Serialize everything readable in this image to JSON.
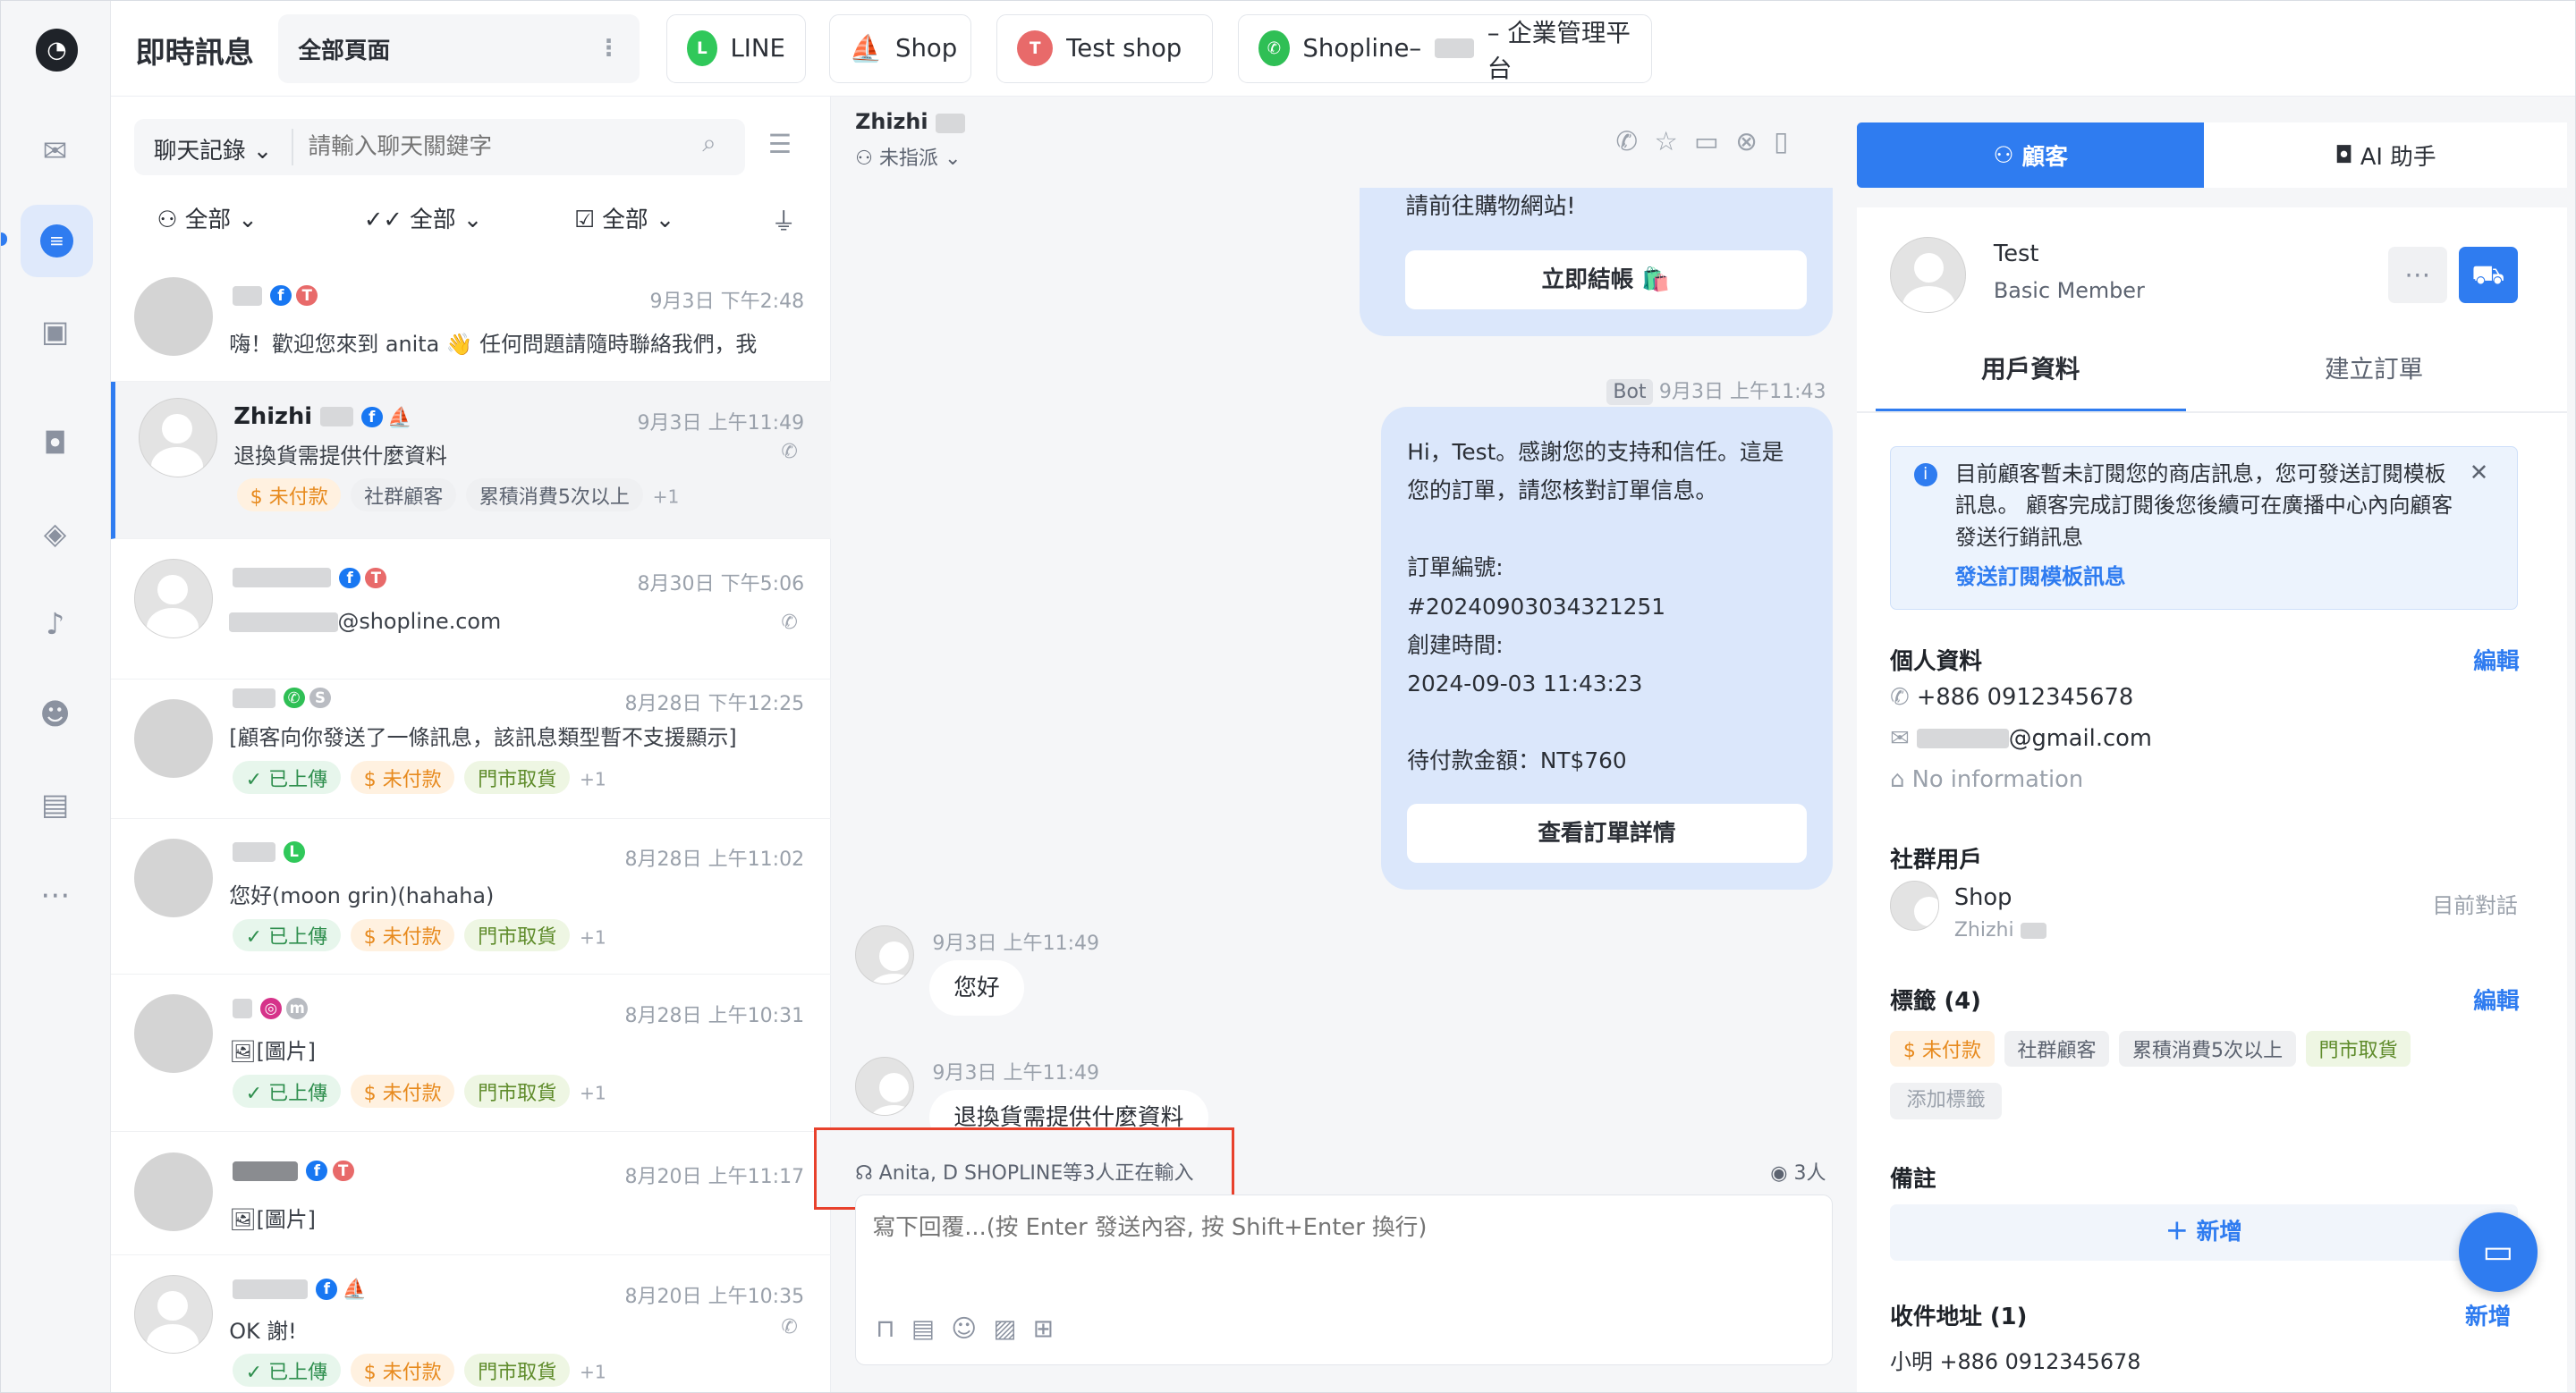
{
  "app": {
    "title": "即時訊息",
    "page_select": "全部頁面"
  },
  "channels": [
    {
      "label": "LINE",
      "icon": "line-icon"
    },
    {
      "label": "Shop",
      "icon": "shop-facebook-icon"
    },
    {
      "label": "Test shop",
      "icon": "test-shop-icon"
    },
    {
      "label": "Shopline–",
      "suffix": "– 企業管理平台",
      "icon": "whatsapp-icon"
    }
  ],
  "rail": [
    "inbox-icon",
    "chat-icon",
    "gallery-icon",
    "bot-icon",
    "tag-icon",
    "bell-icon",
    "agent-icon",
    "broadcast-icon",
    "more-icon"
  ],
  "list": {
    "history_select": "聊天記錄",
    "search_placeholder": "請輸入聊天關鍵字",
    "filters": [
      "全部",
      "全部",
      "全部"
    ],
    "conversations": [
      {
        "name": "",
        "time": "9月3日 下午2:48",
        "message": "嗨！歡迎您來到 anita 👋 任何問題請隨時聯絡我們，我",
        "tags": [],
        "plus": ""
      },
      {
        "name": "Zhizhi",
        "time": "9月3日 上午11:49",
        "message": "退換貨需提供什麼資料",
        "tags": [
          {
            "t": "$ 未付款",
            "c": "orange"
          },
          {
            "t": "社群顧客",
            "c": "gray"
          },
          {
            "t": "累積消費5次以上",
            "c": "gray"
          }
        ],
        "plus": "+1"
      },
      {
        "name": "",
        "time": "8月30日 下午5:06",
        "message": "@shopline.com",
        "tags": [],
        "plus": ""
      },
      {
        "name": "",
        "time": "8月28日 下午12:25",
        "message": "[顧客向你發送了一條訊息，該訊息類型暫不支援顯示]",
        "tags": [
          {
            "t": "✓ 已上傳",
            "c": "green"
          },
          {
            "t": "$ 未付款",
            "c": "orange"
          },
          {
            "t": "門市取貨",
            "c": "lime"
          }
        ],
        "plus": "+1"
      },
      {
        "name": "",
        "time": "8月28日 上午11:02",
        "message": "您好(moon grin)(hahaha)",
        "tags": [
          {
            "t": "✓ 已上傳",
            "c": "green"
          },
          {
            "t": "$ 未付款",
            "c": "orange"
          },
          {
            "t": "門市取貨",
            "c": "lime"
          }
        ],
        "plus": "+1"
      },
      {
        "name": "",
        "time": "8月28日 上午10:31",
        "message": "[圖片]",
        "tags": [
          {
            "t": "✓ 已上傳",
            "c": "green"
          },
          {
            "t": "$ 未付款",
            "c": "orange"
          },
          {
            "t": "門市取貨",
            "c": "lime"
          }
        ],
        "plus": "+1"
      },
      {
        "name": "",
        "time": "8月20日 上午11:17",
        "message": "[圖片]",
        "tags": [],
        "plus": ""
      },
      {
        "name": "",
        "time": "8月20日 上午10:35",
        "message": "OK 謝!",
        "tags": [
          {
            "t": "✓ 已上傳",
            "c": "green"
          },
          {
            "t": "$ 未付款",
            "c": "orange"
          },
          {
            "t": "門市取貨",
            "c": "lime"
          }
        ],
        "plus": "+1"
      }
    ]
  },
  "chat": {
    "name": "Zhizhi",
    "assign": "未指派",
    "bubble1_text": "請前往購物網站!",
    "bubble1_button": "立即結帳 🛍️",
    "bot_label": "Bot",
    "bot_time": "9月3日 上午11:43",
    "bubble2_lines": [
      "Hi，Test。感謝您的支持和信任。這是",
      "您的訂單，請您核對訂單信息。",
      "",
      "訂單編號:",
      "#20240903034321251",
      "創建時間:",
      "2024-09-03 11:43:23",
      "",
      "待付款金額：NT$760"
    ],
    "bubble2_button": "查看訂單詳情",
    "msg1_time": "9月3日 上午11:49",
    "msg1_text": "您好",
    "msg2_time": "9月3日 上午11:49",
    "msg2_text": "退換貨需提供什麼資料",
    "typing": "Anita, D SHOPLINE等3人正在輸入",
    "viewers": "3人",
    "input_placeholder": "寫下回覆...(按 Enter 發送內容, 按 Shift+Enter 換行)"
  },
  "panel": {
    "tab_customer": "顧客",
    "tab_ai": "AI 助手",
    "customer_name": "Test",
    "member": "Basic Member",
    "subtab_profile": "用戶資料",
    "subtab_order": "建立訂單",
    "notice": "目前顧客暫未訂閱您的商店訊息，您可發送訂閱模板訊息。 顧客完成訂閱後您後續可在廣播中心內向顧客發送行銷訊息",
    "notice_link": "發送訂閱模板訊息",
    "personal_title": "個人資料",
    "edit": "編輯",
    "phone": "+886 0912345678",
    "email": "@gmail.com",
    "no_info": "No information",
    "social_title": "社群用戶",
    "social_name": "Shop",
    "social_sub": "Zhizhi",
    "social_status": "目前對話",
    "tags_title": "標籤 (4)",
    "tags": [
      {
        "t": "$ 未付款",
        "c": "orange"
      },
      {
        "t": "社群顧客",
        "c": "gray"
      },
      {
        "t": "累積消費5次以上",
        "c": "gray"
      },
      {
        "t": "門市取貨",
        "c": "lime"
      }
    ],
    "add_tag": "添加標籤",
    "notes_title": "備註",
    "add_note": "＋ 新增",
    "address_title": "收件地址 (1)",
    "address_add": "新增",
    "address_line": "小明 +886 0912345678"
  },
  "colors": {
    "accent": "#2f7cf0",
    "bubble": "#dbe7fb",
    "highlight": "#e8412c"
  }
}
